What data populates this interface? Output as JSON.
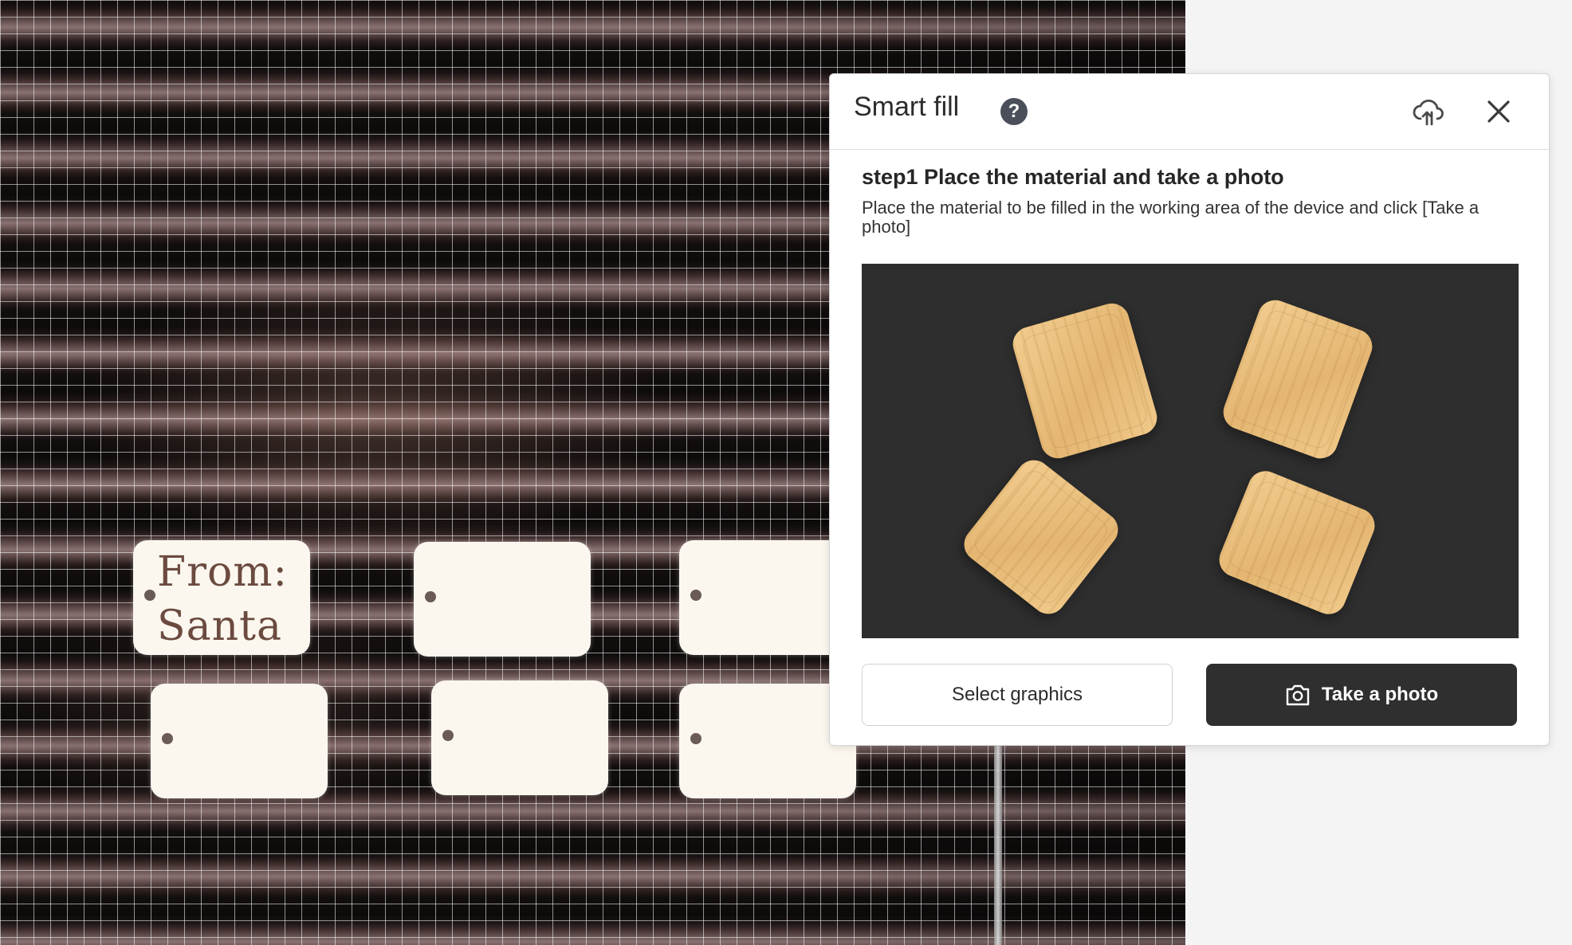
{
  "canvas": {
    "tag_text": [
      "From:",
      "Santa"
    ]
  },
  "dialog": {
    "title": "Smart fill",
    "help_icon_glyph": "?",
    "icons": [
      "help-icon",
      "cloud-upload-icon",
      "close-icon",
      "camera-icon"
    ],
    "step_title": "step1 Place the material and take a photo",
    "step_description": "Place the material to be filled in the working area of the device and click [Take a photo]",
    "buttons": {
      "select_graphics": "Select graphics",
      "take_photo": "Take a photo"
    }
  },
  "colors": {
    "primary_button": "#2f2f2f",
    "preview_background": "#2e2e2e",
    "board": "#e8bd7c"
  }
}
